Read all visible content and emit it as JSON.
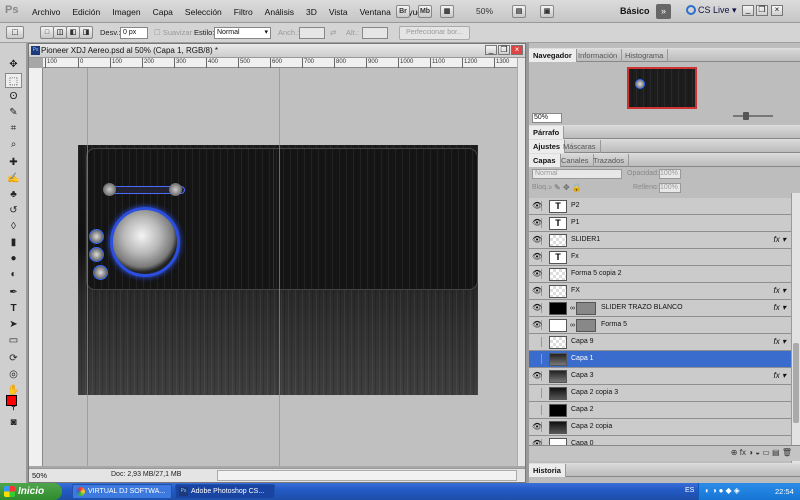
{
  "app": {
    "logo": "Ps"
  },
  "menu": [
    "Archivo",
    "Edición",
    "Imagen",
    "Capa",
    "Selección",
    "Filtro",
    "Análisis",
    "3D",
    "Vista",
    "Ventana",
    "Ayuda"
  ],
  "appbar": {
    "zoom": "50%",
    "workspace": "Básico",
    "cslive": "CS Live"
  },
  "options": {
    "desv_label": "Desv.:",
    "desv_value": "0 px",
    "suavizar_label": "Suavizar",
    "estilo_label": "Estilo:",
    "estilo_value": "Normal",
    "anchura_label": "Anch.:",
    "altura_label": "Alt.:",
    "perfeccionar_label": "Perfeccionar bor..."
  },
  "document": {
    "title": "Pioneer XDJ Aereo.psd al 50% (Capa 1, RGB/8) *",
    "zoom": "50%",
    "doc_info": "Doc: 2,93 MB/27,1 MB",
    "ruler_ticks": [
      "100",
      "0",
      "100",
      "200",
      "300",
      "400",
      "500",
      "600",
      "700",
      "800",
      "900",
      "1000",
      "1100",
      "1200",
      "1300"
    ]
  },
  "navigator": {
    "tabs": [
      "Navegador",
      "Información",
      "Histograma"
    ],
    "zoom": "50%"
  },
  "panels": {
    "parrafo": "Párrafo",
    "ajustes_tabs": [
      "Ajustes",
      "Máscaras"
    ],
    "capas_tabs": [
      "Capas",
      "Canales",
      "Trazados"
    ],
    "blend_mode": "Normal",
    "opacity_label": "Opacidad:",
    "opacity_value": "100%",
    "lock_label": "Bloq.:",
    "fill_label": "Relleno:",
    "fill_value": "100%",
    "historia": "Historia"
  },
  "layers": [
    {
      "name": "P2",
      "type": "text",
      "visible": true,
      "fx": false,
      "selected": false
    },
    {
      "name": "P1",
      "type": "text",
      "visible": true,
      "fx": false,
      "selected": false
    },
    {
      "name": "SLIDER1",
      "type": "pixel",
      "visible": true,
      "fx": true,
      "selected": false
    },
    {
      "name": "Fx",
      "type": "text",
      "visible": true,
      "fx": false,
      "selected": false
    },
    {
      "name": "Forma 5 copia 2",
      "type": "pixel",
      "visible": true,
      "fx": false,
      "selected": false
    },
    {
      "name": "FX",
      "type": "pixel",
      "visible": true,
      "fx": true,
      "selected": false
    },
    {
      "name": "SLIDER TRAZO BLANCO",
      "type": "shape-black",
      "visible": true,
      "fx": true,
      "selected": false
    },
    {
      "name": "Forma 5",
      "type": "shape-white",
      "visible": true,
      "fx": false,
      "selected": false
    },
    {
      "name": "Capa 9",
      "type": "pixel",
      "visible": false,
      "fx": true,
      "selected": false
    },
    {
      "name": "Capa 1",
      "type": "image",
      "visible": false,
      "fx": false,
      "selected": true
    },
    {
      "name": "Capa 3",
      "type": "image",
      "visible": true,
      "fx": true,
      "selected": false
    },
    {
      "name": "Capa 2 copia 3",
      "type": "dark",
      "visible": false,
      "fx": false,
      "selected": false
    },
    {
      "name": "Capa 2",
      "type": "black",
      "visible": false,
      "fx": false,
      "selected": false
    },
    {
      "name": "Capa 2 copia",
      "type": "dark",
      "visible": true,
      "fx": false,
      "selected": false
    },
    {
      "name": "Capa 0",
      "type": "white",
      "visible": true,
      "fx": false,
      "selected": false
    }
  ],
  "taskbar": {
    "start": "Inicio",
    "tasks": [
      "VIRTUAL DJ SOFTWA...",
      "Adobe Photoshop CS..."
    ],
    "lang": "ES",
    "clock": "22:54"
  }
}
